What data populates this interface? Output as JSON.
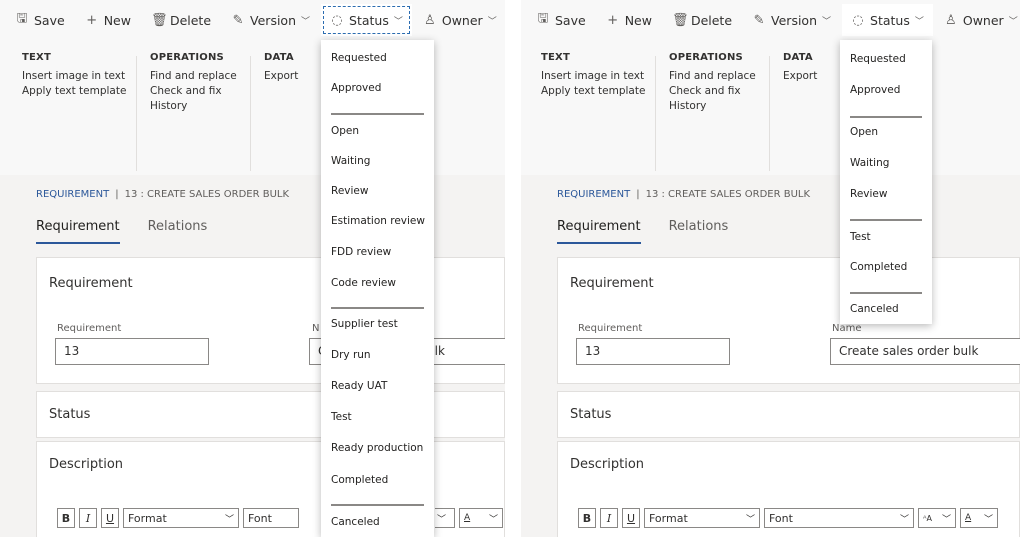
{
  "toolbar": {
    "save": "Save",
    "new": "New",
    "delete": "Delete",
    "version": "Version",
    "status": "Status",
    "owner": "Owner",
    "icons": {
      "save": "save-icon",
      "new": "plus-icon",
      "delete": "trash-icon",
      "version": "edit-icon",
      "status": "status-ring-icon",
      "owner": "person-icon"
    }
  },
  "ribbon": {
    "text_head": "TEXT",
    "text_items": [
      "Insert image in text",
      "Apply text template"
    ],
    "operations_head": "OPERATIONS",
    "operations_items": [
      "Find and replace",
      "Check and fix",
      "History"
    ],
    "data_head": "DATA",
    "data_items": [
      "Export"
    ]
  },
  "breadcrumb": {
    "link": "REQUIREMENT",
    "separator": "|",
    "current": "13 : CREATE SALES ORDER BULK"
  },
  "tabs": [
    "Requirement",
    "Relations"
  ],
  "requirement_card": {
    "title": "Requirement",
    "id_label": "Requirement",
    "id_value": "13",
    "name_label": "Name",
    "name_value": "Create sales order bulk",
    "name_value_left_partial": "ulk",
    "name_left_first_char": "C",
    "name_label_left_partial": "N"
  },
  "status_card": {
    "title": "Status"
  },
  "description_card": {
    "title": "Description",
    "bold": "B",
    "italic": "I",
    "underline": "U",
    "format": "Format",
    "font": "Font",
    "font_size_icon": "ᴬA",
    "font_color_icon": "A"
  },
  "status_menu_left": [
    "Requested",
    "Approved",
    "Open",
    "Waiting",
    "Review",
    "Estimation review",
    "FDD review",
    "Code review",
    "Supplier test",
    "Dry run",
    "Ready UAT",
    "Test",
    "Ready production",
    "Completed",
    "Canceled"
  ],
  "status_menu_right": [
    "Requested",
    "Approved",
    "Open",
    "Waiting",
    "Review",
    "Test",
    "Completed",
    "Canceled"
  ],
  "colors": {
    "accent": "#2b579a",
    "toolbar_bg": "#f8f8f8",
    "content_bg": "#f4f3f2",
    "card_bg": "#ffffff"
  }
}
